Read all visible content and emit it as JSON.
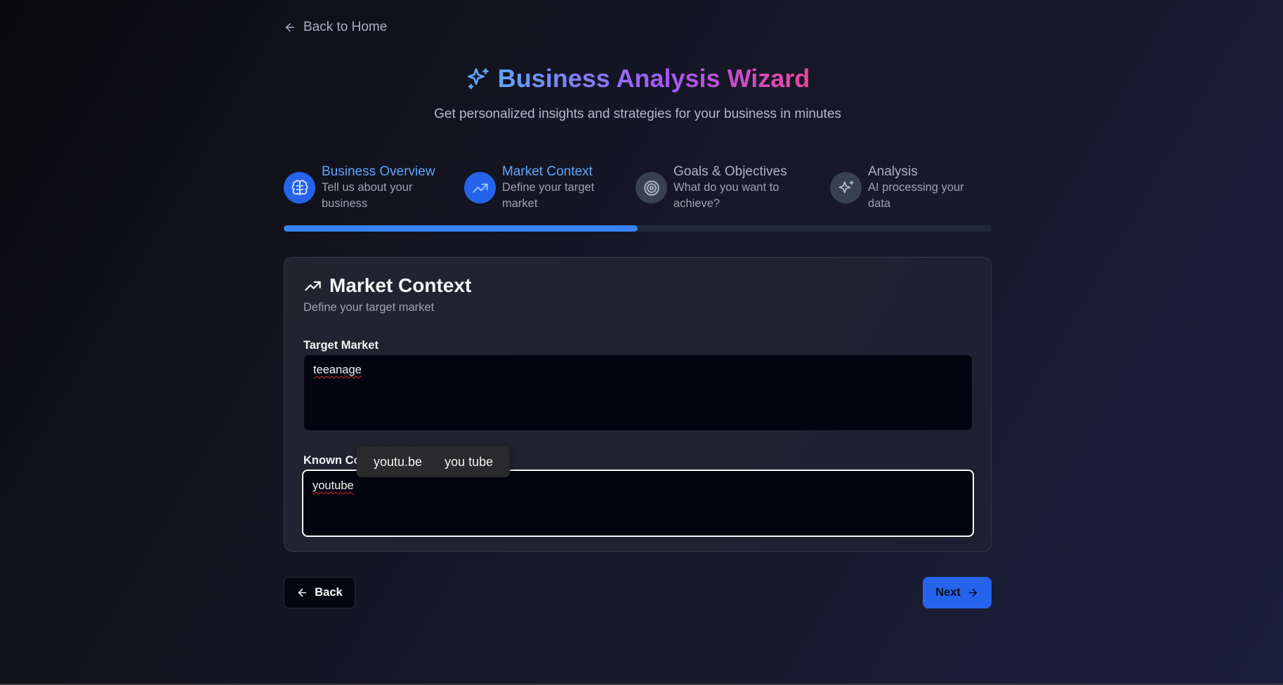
{
  "nav": {
    "back_home": "Back to Home"
  },
  "header": {
    "title": "Business Analysis Wizard",
    "subtitle": "Get personalized insights and strategies for your business in minutes"
  },
  "steps": [
    {
      "title": "Business Overview",
      "desc": "Tell us about your business",
      "icon": "brain-icon",
      "state": "complete"
    },
    {
      "title": "Market Context",
      "desc": "Define your target market",
      "icon": "trending-up-icon",
      "state": "active"
    },
    {
      "title": "Goals & Objectives",
      "desc": "What do you want to achieve?",
      "icon": "target-icon",
      "state": "pending"
    },
    {
      "title": "Analysis",
      "desc": "AI processing your data",
      "icon": "sparkles-icon",
      "state": "pending"
    }
  ],
  "progress": {
    "fraction": 0.5
  },
  "card": {
    "title": "Market Context",
    "subtitle": "Define your target market",
    "target_market": {
      "label": "Target Market",
      "value": "teeanage"
    },
    "competitors": {
      "label": "Known Co",
      "value": "youtube"
    }
  },
  "spell_suggestions": [
    "youtu.be",
    "you tube"
  ],
  "buttons": {
    "back": "Back",
    "next": "Next"
  },
  "colors": {
    "accent": "#2563eb",
    "progress": "#3b82f6",
    "title_gradient": [
      "#60a5fa",
      "#a855f7",
      "#ec4899"
    ]
  }
}
